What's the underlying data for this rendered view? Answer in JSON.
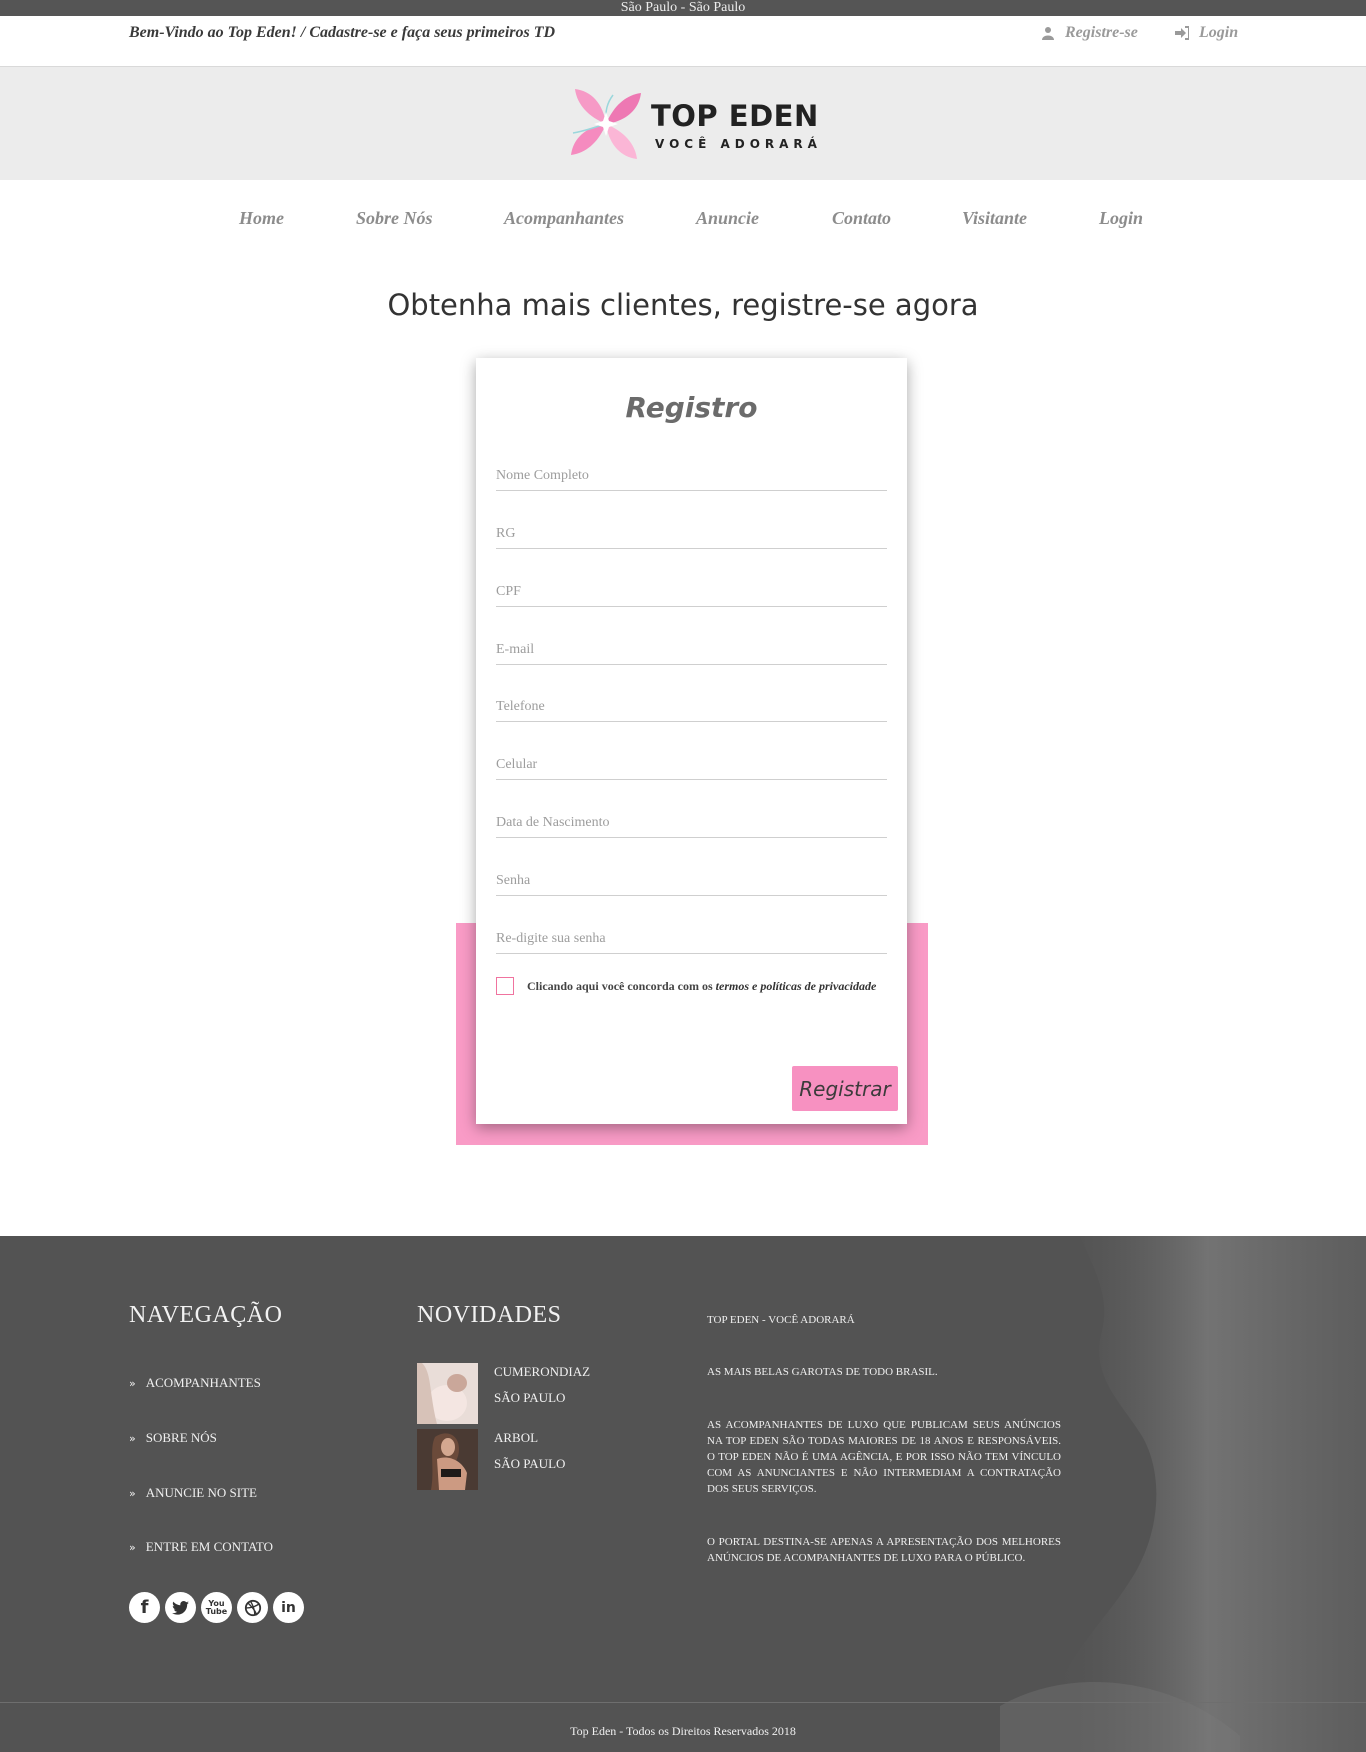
{
  "topbar": {
    "location": "São Paulo - São Paulo"
  },
  "welcome": {
    "text": "Bem-Vindo ao Top Eden! / Cadastre-se e faça seus primeiros TD",
    "register_label": "Registre-se",
    "login_label": "Login"
  },
  "logo": {
    "name": "TOP EDEN",
    "tagline": "VOCÊ ADORARÁ"
  },
  "nav": {
    "items": [
      "Home",
      "Sobre Nós",
      "Acompanhantes",
      "Anuncie",
      "Contato",
      "Visitante",
      "Login"
    ]
  },
  "page": {
    "heading": "Obtenha mais clientes, registre-se agora"
  },
  "form": {
    "title": "Registro",
    "fields": [
      "Nome Completo",
      "RG",
      "CPF",
      "E-mail",
      "Telefone",
      "Celular",
      "Data de Nascimento",
      "Senha",
      "Re-digite sua senha"
    ],
    "terms_prefix": "Clicando aqui você concorda com os ",
    "terms_link": "termos e políticas de privacidade",
    "submit_label": "Registrar",
    "checkbox_color": "#f0739f",
    "accent": "#f791c1"
  },
  "footer": {
    "nav_heading": "NAVEGAÇÃO",
    "nav_items": [
      "ACOMPANHANTES",
      "SOBRE NÓS",
      "ANUNCIE NO SITE",
      "ENTRE EM CONTATO"
    ],
    "socials": [
      "facebook-icon",
      "twitter-icon",
      "youtube-icon",
      "dribbble-icon",
      "linkedin-icon"
    ],
    "news_heading": "NOVIDADES",
    "news": [
      {
        "name": "CUMERONDIAZ",
        "city": "SÃO PAULO"
      },
      {
        "name": "ARBOL",
        "city": "SÃO PAULO"
      }
    ],
    "about_title": "TOP EDEN - VOCÊ ADORARÁ",
    "about_p1": "AS MAIS BELAS GAROTAS DE TODO BRASIL.",
    "about_p2": "AS ACOMPANHANTES DE LUXO QUE PUBLICAM SEUS ANÚNCIOS NA TOP EDEN SÃO TODAS MAIORES DE 18 ANOS E RESPONSÁVEIS. O TOP EDEN NÃO É UMA AGÊNCIA, E POR ISSO NÃO TEM VÍNCULO COM AS ANUNCIANTES E NÃO INTERMEDIAM A CONTRATAÇÃO DOS SEUS SERVIÇOS.",
    "about_p3": "O PORTAL DESTINA-SE APENAS A APRESENTAÇÃO DOS MELHORES ANÚNCIOS DE ACOMPANHANTES DE LUXO PARA O PÚBLICO.",
    "copyright": "Top Eden - Todos os Direitos Reservados 2018"
  }
}
